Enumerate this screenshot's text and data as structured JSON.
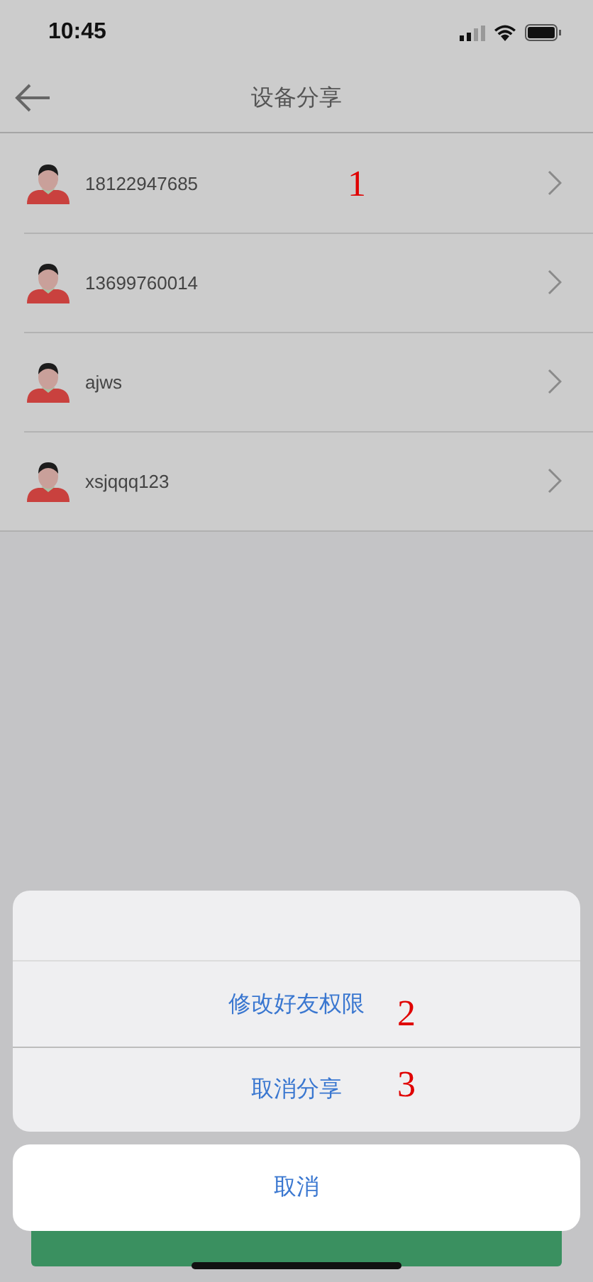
{
  "status_bar": {
    "time": "10:45"
  },
  "nav": {
    "title": "设备分享"
  },
  "friends": [
    {
      "name": "18122947685"
    },
    {
      "name": "13699760014"
    },
    {
      "name": "ajws"
    },
    {
      "name": "xsjqqq123"
    }
  ],
  "action_sheet": {
    "options": [
      "修改好友权限",
      "取消分享"
    ],
    "cancel": "取消"
  },
  "annotations": [
    "1",
    "2",
    "3"
  ]
}
